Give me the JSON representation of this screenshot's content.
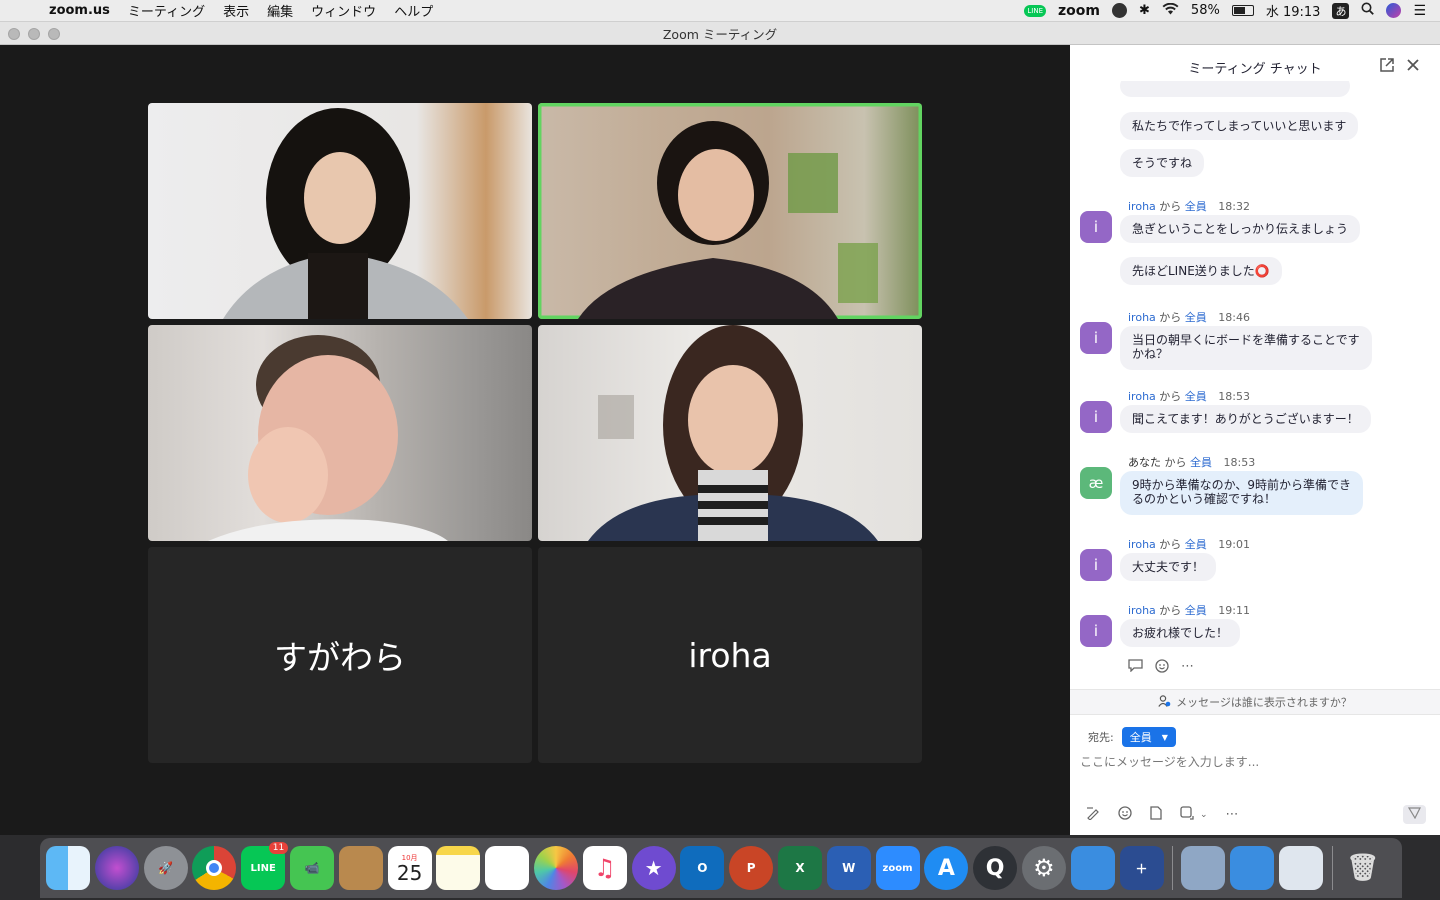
{
  "menubar": {
    "app_name": "zoom.us",
    "items": [
      "ミーティング",
      "表示",
      "編集",
      "ウィンドウ",
      "ヘルプ"
    ],
    "status": {
      "line_badge": "LINE",
      "zoom_label": "zoom",
      "battery": "58%",
      "clock": "水 19:13",
      "ime": "あ"
    }
  },
  "window": {
    "title": "Zoom ミーティング"
  },
  "video": {
    "name_tiles": [
      "すがわら",
      "iroha"
    ],
    "participant_tiles": [
      "participant-1",
      "participant-2",
      "participant-3",
      "participant-4"
    ]
  },
  "chat": {
    "title": "ミーティング チャット",
    "messages": [
      {
        "text": "私たちで作ってしまっていいと思います"
      },
      {
        "text": "そうですね"
      },
      {
        "sender": "iroha",
        "from": "から",
        "to": "全員",
        "time": "18:32",
        "avatar": "i",
        "texts": [
          "急ぎということをしっかり伝えましょう",
          "先ほどLINE送りました⭕"
        ]
      },
      {
        "sender": "iroha",
        "from": "から",
        "to": "全員",
        "time": "18:46",
        "avatar": "i",
        "texts": [
          "当日の朝早くにボードを準備することです",
          "かね？"
        ]
      },
      {
        "sender": "iroha",
        "from": "から",
        "to": "全員",
        "time": "18:53",
        "avatar": "i",
        "texts": [
          "聞こえてます！ありがとうございますー！"
        ]
      },
      {
        "sender": "あなた",
        "from": "から",
        "to": "全員",
        "time": "18:53",
        "avatar": "æ",
        "texts": [
          "9時から準備なのか、9時前から準備でき",
          "るのかという確認ですね！"
        ]
      },
      {
        "sender": "iroha",
        "from": "から",
        "to": "全員",
        "time": "19:01",
        "avatar": "i",
        "texts": [
          "大丈夫です！"
        ]
      },
      {
        "sender": "iroha",
        "from": "から",
        "to": "全員",
        "time": "19:11",
        "avatar": "i",
        "texts": [
          "お疲れ様でした！"
        ]
      }
    ],
    "visibility_note": "メッセージは誰に表示されますか？",
    "to_label": "宛先:",
    "to_value": "全員",
    "input_placeholder": "ここにメッセージを入力します..."
  },
  "dock": {
    "calendar_month": "10月",
    "calendar_day": "25",
    "line_badge_count": "11",
    "zoom_label": "zoom",
    "apps": [
      "finder",
      "siri",
      "launchpad",
      "chrome",
      "line",
      "facetime",
      "contacts",
      "calendar",
      "notes",
      "reminders",
      "photos",
      "music",
      "imovie",
      "outlook",
      "powerpoint",
      "excel",
      "word",
      "zoom",
      "app-store",
      "quicktime",
      "system-preferences",
      "migration-assistant",
      "font-book",
      "preview",
      "network-utility",
      "stickies",
      "trash"
    ]
  }
}
